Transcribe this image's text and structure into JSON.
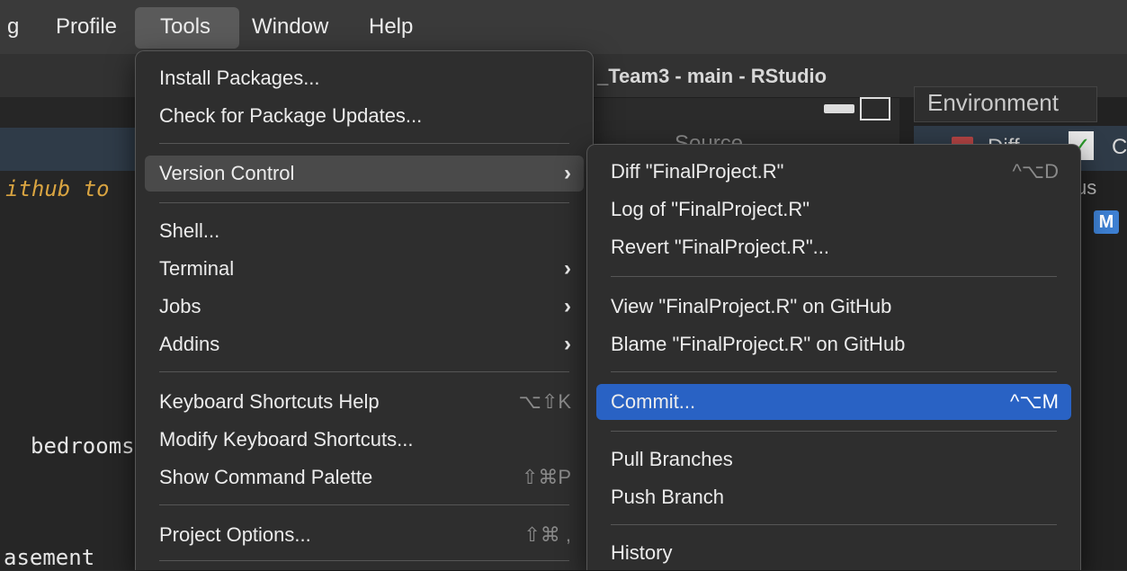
{
  "menubar": {
    "items": [
      "g",
      "Profile",
      "Tools",
      "Window",
      "Help"
    ]
  },
  "window": {
    "title": "_Team3 - main - RStudio",
    "environment_tab": "Environment",
    "source_button": "Source",
    "diff_button": "Diff",
    "commit_button_partial": "C",
    "status_header": "us",
    "modified_badge": "M"
  },
  "editor": {
    "lines": [
      "ithub to",
      "bedrooms",
      "asement"
    ]
  },
  "tools_menu": {
    "items": [
      {
        "label": "Install Packages...",
        "shortcut": ""
      },
      {
        "label": "Check for Package Updates...",
        "shortcut": ""
      },
      {
        "label": "Version Control",
        "shortcut": "",
        "submenu": "›"
      },
      {
        "label": "Shell...",
        "shortcut": ""
      },
      {
        "label": "Terminal",
        "shortcut": "",
        "submenu": "›"
      },
      {
        "label": "Jobs",
        "shortcut": "",
        "submenu": "›"
      },
      {
        "label": "Addins",
        "shortcut": "",
        "submenu": "›"
      },
      {
        "label": "Keyboard Shortcuts Help",
        "shortcut": "⌥⇧K"
      },
      {
        "label": "Modify Keyboard Shortcuts...",
        "shortcut": ""
      },
      {
        "label": "Show Command Palette",
        "shortcut": "⇧⌘P"
      },
      {
        "label": "Project Options...",
        "shortcut": "⇧⌘ ,"
      }
    ]
  },
  "vc_menu": {
    "items": [
      {
        "label": "Diff \"FinalProject.R\"",
        "shortcut": "^⌥D"
      },
      {
        "label": "Log of \"FinalProject.R\"",
        "shortcut": ""
      },
      {
        "label": "Revert \"FinalProject.R\"...",
        "shortcut": ""
      },
      {
        "label": "View \"FinalProject.R\" on GitHub",
        "shortcut": ""
      },
      {
        "label": "Blame \"FinalProject.R\" on GitHub",
        "shortcut": ""
      },
      {
        "label": "Commit...",
        "shortcut": "^⌥M"
      },
      {
        "label": "Pull Branches",
        "shortcut": ""
      },
      {
        "label": "Push Branch",
        "shortcut": ""
      },
      {
        "label": "History",
        "shortcut": ""
      }
    ]
  },
  "colors": {
    "highlight_blue": "#2962c4",
    "highlight_grey": "#4a4a4a",
    "editor_accent": "#d9a441"
  }
}
